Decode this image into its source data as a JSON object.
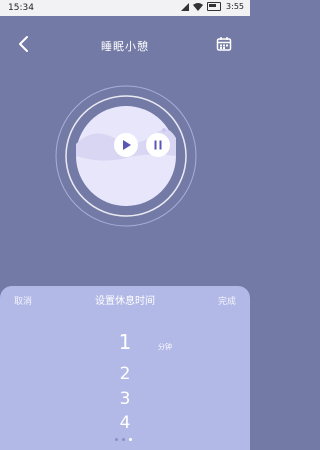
{
  "status": {
    "time": "15:34",
    "battery_pct": "3:55"
  },
  "header": {
    "title": "睡眠小憩"
  },
  "sheet": {
    "cancel_label": "取消",
    "title": "设置休息时间",
    "done_label": "完成",
    "options": [
      "1",
      "2",
      "3",
      "4"
    ],
    "selected_index": 0,
    "unit": "分钟"
  },
  "icons": [
    "back-arrow-icon",
    "calendar-icon",
    "play-icon",
    "pause-icon"
  ],
  "colors": {
    "background": "#747aa6",
    "sheet": "#b3b9e6",
    "accent": "#5a56b8",
    "disc": "#e7e6fb"
  },
  "pager": {
    "count": 3,
    "active_index": 2
  }
}
